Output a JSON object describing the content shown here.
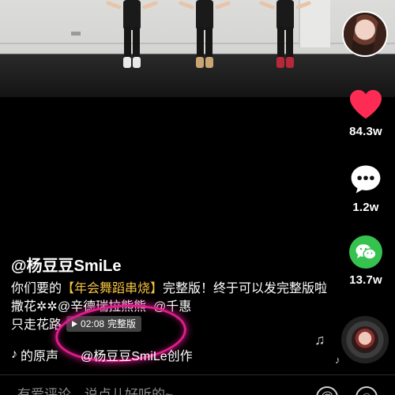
{
  "author": "@杨豆豆SmiLe",
  "description": {
    "part1": "你们要的",
    "tag": "【年会舞蹈串烧】",
    "part2": "完整版！终于可以发完整版啦撒花✲✲",
    "mention1": "@辛德瑞拉熊熊",
    "mention2": "@千惠",
    "part3": "只走花路"
  },
  "full_version": {
    "duration": "02:08",
    "label": "完整版",
    "icon": "play-triangle-icon"
  },
  "music": {
    "icon": "tiktok-note-icon",
    "original_sound": "的原声",
    "creator": "@杨豆豆SmiLe创作"
  },
  "actions": {
    "like_count": "84.3w",
    "comment_count": "1.2w",
    "share_count": "13.7w",
    "like_icon": "heart-icon",
    "comment_icon": "comment-bubble-icon",
    "share_icon": "wechat-icon"
  },
  "comment_input": {
    "placeholder": "有爱评论，说点儿好听的~"
  },
  "colors": {
    "like": "#fe2c55",
    "wechat": "#36c24f",
    "tag": "#f5c242",
    "highlight_ring": "#e31c8e"
  }
}
